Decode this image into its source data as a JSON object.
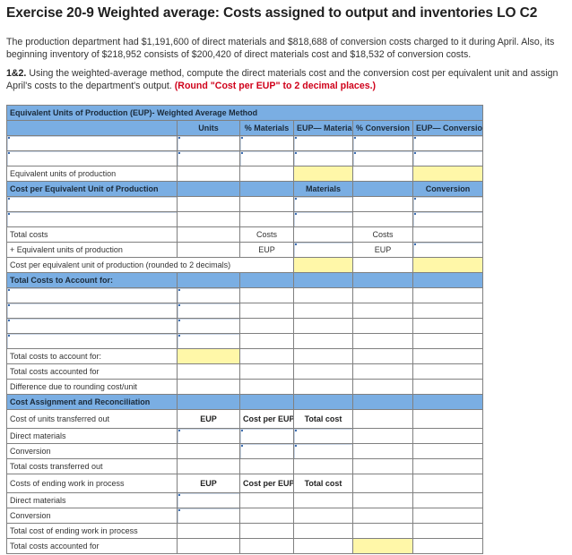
{
  "header": {
    "title": "Exercise 20-9 Weighted average: Costs assigned to output and inventories LO C2"
  },
  "problem": {
    "paragraph1": "The production department had $1,191,600 of direct materials and $818,688 of conversion costs charged to it during April. Also, its beginning inventory of $218,952 consists of $200,420 of direct materials cost and $18,532 of conversion costs.",
    "part_label": "1&2.",
    "instructions": " Using the weighted-average method, compute the direct materials cost and the conversion cost per equivalent unit and assign April's costs to the department's output. ",
    "rounding_note": "(Round \"Cost per EUP\" to 2 decimal places.)"
  },
  "eup_section": {
    "title": "Equivalent Units of Production (EUP)- Weighted Average Method",
    "columns": [
      "Units",
      "% Materials",
      "EUP— Materials",
      "% Conversion",
      "EUP— Conversion"
    ],
    "rows": [
      {
        "label": "",
        "units": "",
        "pct_materials": "",
        "eup_materials": "",
        "pct_conversion": "",
        "eup_conversion": ""
      },
      {
        "label": "",
        "units": "",
        "pct_materials": "",
        "eup_materials": "",
        "pct_conversion": "",
        "eup_conversion": ""
      }
    ],
    "total_label": "Equivalent units of production",
    "total_eup_materials": "",
    "total_eup_conversion": ""
  },
  "cost_per_eup_section": {
    "title": "Cost per Equivalent Unit of Production",
    "materials_header": "Materials",
    "conversion_header": "Conversion",
    "rows": [
      {
        "label": "",
        "materials": "",
        "conversion": ""
      },
      {
        "label": "",
        "materials": "",
        "conversion": ""
      }
    ],
    "total_costs_label": "Total costs",
    "costs_tag": "Costs",
    "divide_label": "+ Equivalent units of production",
    "eup_tag": "EUP",
    "cost_per_unit_label": "Cost per equivalent unit of production (rounded to 2 decimals)"
  },
  "total_costs_section": {
    "title": "Total Costs to Account for:",
    "rows": [
      {
        "label": "",
        "value": ""
      },
      {
        "label": "",
        "value": ""
      },
      {
        "label": "",
        "value": ""
      },
      {
        "label": "",
        "value": ""
      }
    ],
    "to_account_label": "Total costs to account for:",
    "accounted_label": "Total costs accounted for",
    "difference_label": "Difference due to rounding cost/unit"
  },
  "assignment_section": {
    "title": "Cost Assignment and Reconciliation",
    "transferred_label": "Cost of units transferred out",
    "col_eup": "EUP",
    "col_cost_per_eup": "Cost per EUP",
    "col_total_cost": "Total cost",
    "direct_materials_label": "Direct materials",
    "conversion_label": "Conversion",
    "total_transferred_label": "Total costs transferred out",
    "ending_wip_label": "Costs of ending work in process",
    "total_ending_wip_label": "Total cost of ending work in process",
    "total_accounted_label": "Total costs accounted for"
  },
  "colors": {
    "header_blue": "#7aaee3",
    "highlight_yellow": "#fff7a8",
    "instruction_red": "#d0021b"
  }
}
